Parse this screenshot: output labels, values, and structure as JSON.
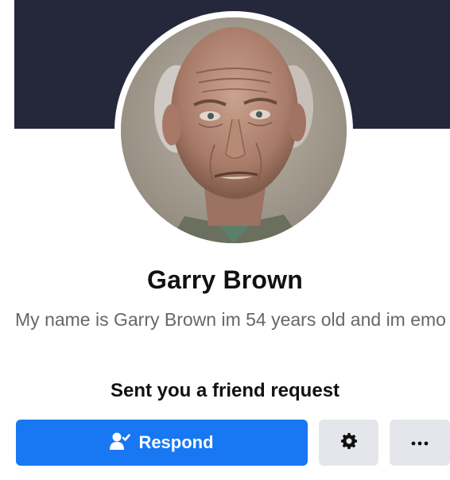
{
  "profile": {
    "name": "Garry Brown",
    "bio": "My name is Garry Brown im 54 years old and im emo",
    "request_text": "Sent you a friend request"
  },
  "actions": {
    "respond_label": "Respond",
    "respond_icon": "person-respond-icon",
    "settings_icon": "gear-icon",
    "more_icon": "more-dots-icon"
  },
  "colors": {
    "cover": "#24283a",
    "primary_button": "#1877f2",
    "secondary_button": "#e4e6eb",
    "bio_text": "#65676b"
  }
}
